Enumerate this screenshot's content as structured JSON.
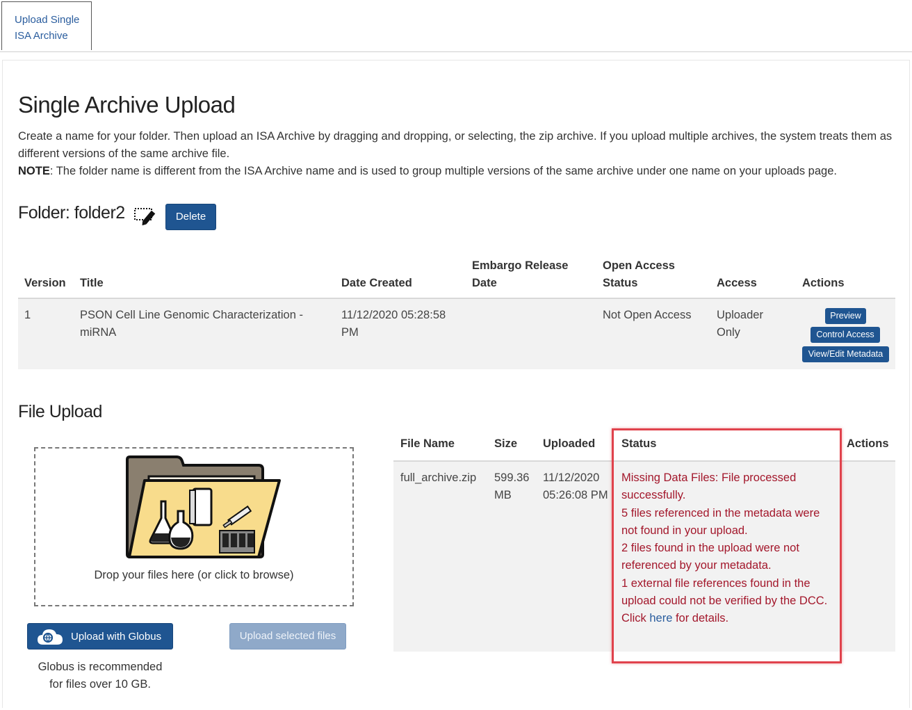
{
  "tab": {
    "line1": "Upload Single",
    "line2": "ISA Archive"
  },
  "page": {
    "title": "Single Archive Upload",
    "intro": "Create a name for your folder. Then upload an ISA Archive by dragging and dropping, or selecting, the zip archive. If you upload multiple archives, the system treats them as different versions of the same archive file.",
    "note_label": "NOTE",
    "note_text": ": The folder name is different from the ISA Archive name and is used to group multiple versions of the same archive under one name on your uploads page."
  },
  "folder": {
    "title": "Folder: folder2",
    "edit_icon": "edit-pencil-icon",
    "delete_label": "Delete"
  },
  "versions_table": {
    "headers": {
      "version": "Version",
      "title": "Title",
      "date_created": "Date Created",
      "embargo_1": "Embargo Release",
      "embargo_2": "Date",
      "open_access_1": "Open Access",
      "open_access_2": "Status",
      "access": "Access",
      "actions": "Actions"
    },
    "rows": [
      {
        "version": "1",
        "title_1": "PSON Cell Line Genomic Characterization -",
        "title_2": "miRNA",
        "date_1": "11/12/2020 05:28:58",
        "date_2": "PM",
        "embargo": "",
        "open_access": "Not Open Access",
        "access_1": "Uploader",
        "access_2": "Only",
        "actions": {
          "preview": "Preview",
          "control_access": "Control Access",
          "edit_metadata": "View/Edit Metadata"
        }
      }
    ]
  },
  "file_upload": {
    "title": "File Upload",
    "drop_text": "Drop your files here (or click to browse)",
    "globus_button": "Upload with Globus",
    "upload_selected_button": "Upload selected files",
    "globus_note_1": "Globus is recommended",
    "globus_note_2": "for files over 10 GB."
  },
  "files_table": {
    "headers": {
      "file_name": "File Name",
      "size": "Size",
      "uploaded": "Uploaded",
      "status": "Status",
      "actions": "Actions"
    },
    "rows": [
      {
        "file_name": "full_archive.zip",
        "size_1": "599.36",
        "size_2": "MB",
        "uploaded_1": "11/12/2020",
        "uploaded_2": "05:26:08 PM",
        "status_1": "Missing Data Files: File processed successfully.",
        "status_2": "5 files referenced in the metadata were not found in your upload.",
        "status_3": "2 files found in the upload were not referenced by your metadata.",
        "status_4": "1 external file references found in the upload could not be verified by the DCC.",
        "status_5_pre": "Click ",
        "status_5_link": "here",
        "status_5_post": " for details."
      }
    ]
  },
  "colors": {
    "primary": "#1f5591",
    "status_error": "#a3172b",
    "link": "#2a5d9e",
    "highlight": "#e0424c"
  }
}
